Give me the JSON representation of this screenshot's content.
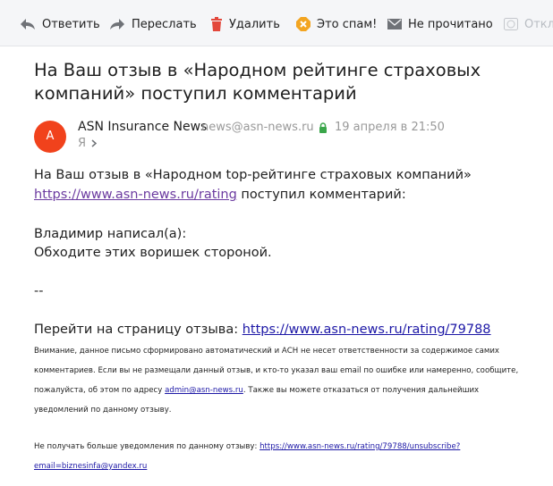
{
  "toolbar": {
    "reply_label": "Ответить",
    "forward_label": "Переслать",
    "delete_label": "Удалить",
    "spam_label": "Это спам!",
    "unread_label": "Не прочитано",
    "more_label": "Откл"
  },
  "message": {
    "subject_line1": "На Ваш отзыв в «Народном рейтинге страховых",
    "subject_line2": "компаний» поступил комментарий",
    "avatar_letter": "A",
    "sender_name": "ASN Insurance News",
    "sender_email": "news@asn-news.ru",
    "date": "19 апреля в 21:50",
    "recipient": "Я"
  },
  "body": {
    "intro": "На Ваш отзыв в «Народном top-рейтинге страховых компаний»",
    "rating_link": "https://www.asn-news.ru/rating",
    "intro_suffix": " поступил комментарий:",
    "author_line": "Владимир написал(а):",
    "comment": "Обходите этих воришек стороной.",
    "separator": "--",
    "goto_label": "Перейти на страницу отзыва: ",
    "review_link": "https://www.asn-news.ru/rating/79788",
    "notice_line1": "Внимание, данное письмо сформировано автоматический и АСН не несет ответственности за содержимое самих",
    "notice_line2": "комментариев. Если вы не размещали данный отзыв, и кто-то указал ваш email по ошибке или намеренно, сообщите,",
    "notice_line3_prefix": "пожалуйста, об этом по адресу ",
    "admin_email": "admin@asn-news.ru",
    "notice_line3_suffix": ". Также вы можете отказаться от получения дальнейших",
    "notice_line4": "уведомлений по данному отзыву.",
    "unsub_label": "Не получать больше уведомления по данному отзыву: ",
    "unsub_link_line1": "https://www.asn-news.ru/rating/79788/unsubscribe?",
    "unsub_link_line2": "email=biznesinfa@yandex.ru"
  }
}
